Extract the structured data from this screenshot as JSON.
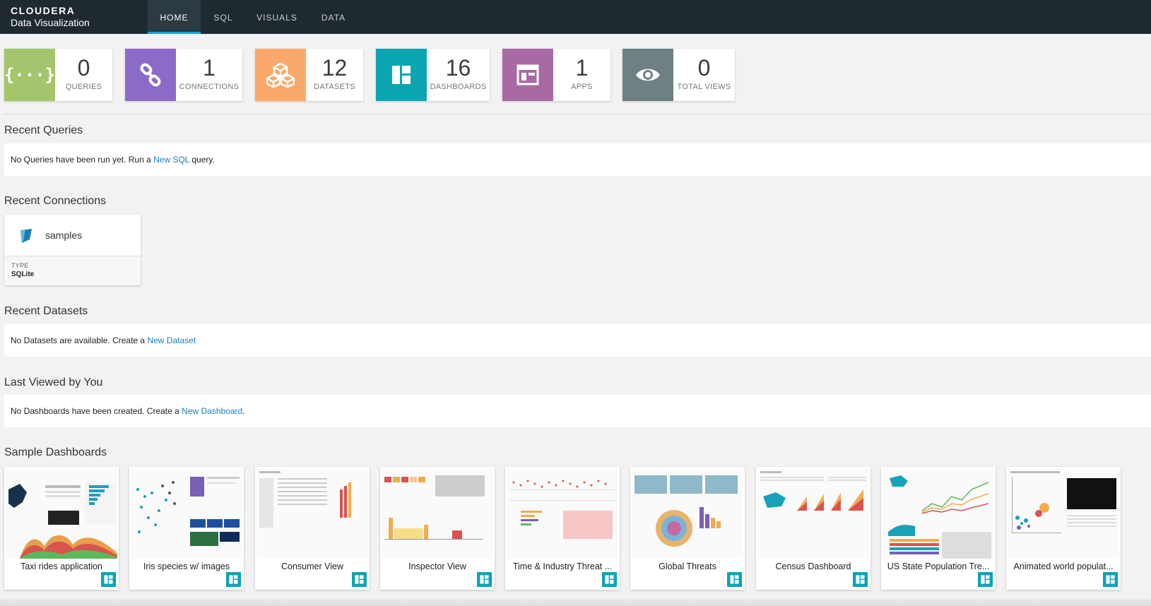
{
  "brand": {
    "line1": "CLOUDERA",
    "line2": "Data Visualization"
  },
  "nav": {
    "tabs": [
      "HOME",
      "SQL",
      "VISUALS",
      "DATA"
    ],
    "active": "HOME"
  },
  "stats": [
    {
      "value": "0",
      "label": "QUERIES",
      "color": "#a4c56b",
      "icon": "braces-icon"
    },
    {
      "value": "1",
      "label": "CONNECTIONS",
      "color": "#8c6bc8",
      "icon": "link-icon"
    },
    {
      "value": "12",
      "label": "DATASETS",
      "color": "#fba96a",
      "icon": "cubes-icon"
    },
    {
      "value": "16",
      "label": "DASHBOARDS",
      "color": "#0ba5b2",
      "icon": "dashboard-icon"
    },
    {
      "value": "1",
      "label": "APPS",
      "color": "#a86aa5",
      "icon": "app-icon"
    },
    {
      "value": "0",
      "label": "TOTAL VIEWS",
      "color": "#6f8085",
      "icon": "eye-icon"
    }
  ],
  "recent_queries": {
    "title": "Recent Queries",
    "pre": "No Queries have been run yet. Run a ",
    "link": "New SQL",
    "post": " query."
  },
  "recent_connections": {
    "title": "Recent Connections",
    "card": {
      "name": "samples",
      "type_label": "TYPE",
      "type_value": "SQLite"
    }
  },
  "recent_datasets": {
    "title": "Recent Datasets",
    "pre": "No Datasets are available. Create a ",
    "link": "New Dataset",
    "post": ""
  },
  "last_viewed": {
    "title": "Last Viewed by You",
    "pre": "No Dashboards have been created. Create a ",
    "link": "New Dashboard",
    "post": "."
  },
  "samples": {
    "title": "Sample Dashboards",
    "items": [
      "Taxi rides application",
      "Iris species w/ images",
      "Consumer View",
      "Inspector View",
      "Time & Industry Threat ...",
      "Global Threats",
      "Census Dashboard",
      "US State Population Tre...",
      "Animated world populat..."
    ]
  },
  "colors": {
    "accent": "#1aa3d4",
    "link": "#1a7fb5",
    "badge": "#0ba5b2",
    "topbar": "#1e2930"
  }
}
